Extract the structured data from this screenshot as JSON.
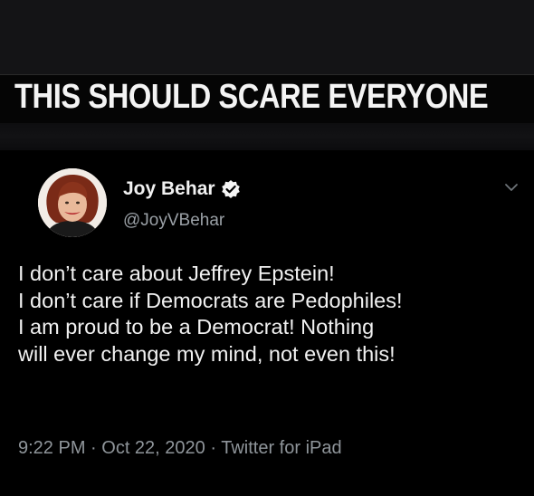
{
  "headline": "THIS SHOULD SCARE EVERYONE",
  "tweet": {
    "display_name": "Joy Behar",
    "handle": "@JoyVBehar",
    "verified": true,
    "lines": [
      "I don’t care about Jeffrey Epstein!",
      "I don’t care if Democrats are Pedophiles!",
      "I am proud to be a Democrat! Nothing",
      "will ever change my mind, not even this!"
    ],
    "time": "9:22 PM",
    "date": "Oct 22, 2020",
    "source": "Twitter for iPad"
  },
  "icons": {
    "verified": "verified-badge-icon",
    "more": "chevron-down-icon"
  },
  "colors": {
    "background": "#000000",
    "verified_badge": "#f5f5f5",
    "meta_text": "#8f959a"
  }
}
